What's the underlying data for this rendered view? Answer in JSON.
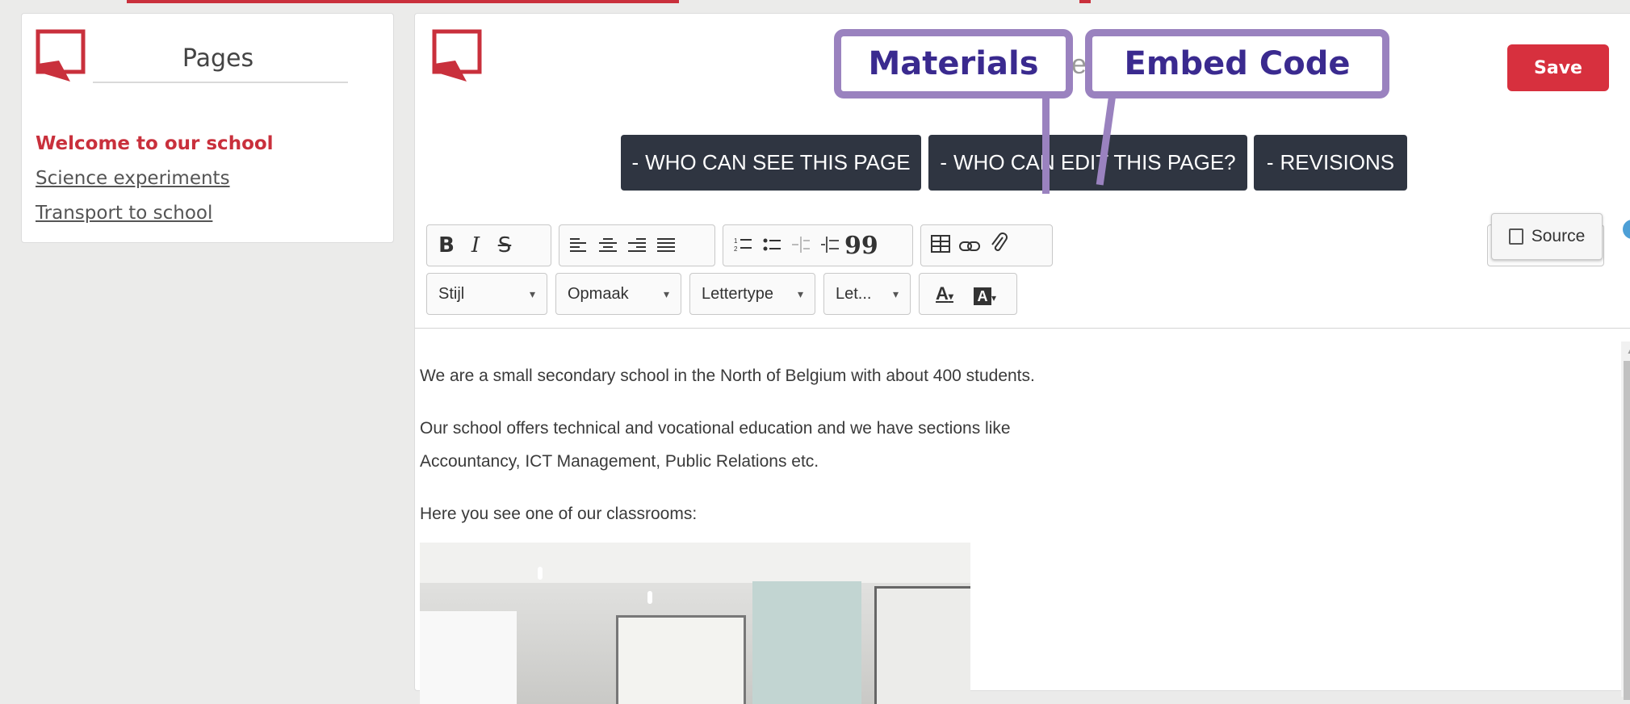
{
  "sidebar": {
    "title": "Pages",
    "items": [
      {
        "label": "Welcome to our school",
        "active": true
      },
      {
        "label": "Science experiments",
        "active": false
      },
      {
        "label": "Transport to school",
        "active": false
      }
    ]
  },
  "editor": {
    "title_fragment": "e",
    "save_label": "Save",
    "buttons": {
      "see": "WHO CAN SEE THIS PAGE",
      "edit": "WHO CAN EDIT THIS PAGE?",
      "revisions": "REVISIONS",
      "dash": "-"
    },
    "toolbar": {
      "bold": "B",
      "italic": "I",
      "strike": "S",
      "quote": "99",
      "style": "Stijl",
      "format": "Opmaak",
      "font": "Lettertype",
      "size": "Let...",
      "text_color": "A",
      "bg_color": "A",
      "source": "Source"
    },
    "content": {
      "paragraphs": [
        "We are a small secondary school in the North of Belgium with about 400 students.",
        "Our school offers technical and vocational education and we have sections like Accountancy, ICT Management, Public Relations etc.",
        "Here you see one of our classrooms:"
      ]
    }
  },
  "callouts": {
    "materials": "Materials",
    "embed": "Embed Code"
  },
  "colors": {
    "accent": "#d7303e",
    "button_dark": "#2f3541",
    "callout_border": "#9a82bf",
    "callout_text": "#3a2a8f"
  }
}
